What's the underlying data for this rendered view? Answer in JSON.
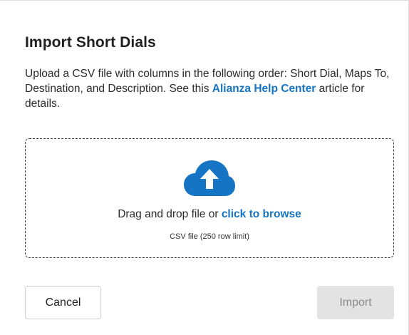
{
  "dialog": {
    "title": "Import Short Dials",
    "description_before": "Upload a CSV file with columns in the following order: Short Dial, Maps To, Destination, and Description. See this ",
    "help_link": "Alianza Help Center",
    "description_after": " article for details.",
    "dropzone": {
      "icon": "cloud-upload-icon",
      "prompt": "Drag and drop file or ",
      "browse_link": "click to browse",
      "limit": "CSV file (250 row limit)"
    },
    "buttons": {
      "cancel": "Cancel",
      "import": "Import"
    }
  },
  "colors": {
    "link": "#1574c4",
    "icon": "#1574c4",
    "disabled_button_bg": "#e3e3e3",
    "disabled_button_text": "#8a8a8a"
  }
}
